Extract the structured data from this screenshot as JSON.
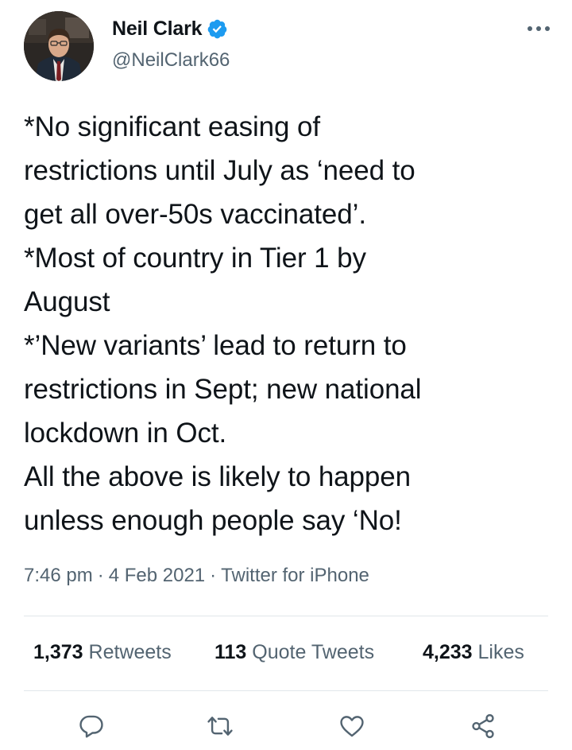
{
  "user": {
    "display_name": "Neil Clark",
    "handle": "@NeilClark66",
    "verified": true,
    "verified_color": "#1d9bf0"
  },
  "tweet": {
    "lines": [
      "*No significant easing of",
      "restrictions until July as ‘need to",
      "get all over-50s vaccinated’.",
      "*Most of country in Tier 1 by",
      "August",
      "*’New variants’ lead to return to",
      "restrictions in Sept; new national",
      "lockdown in Oct.",
      "All the above is likely to happen",
      "unless enough people say ‘No!"
    ]
  },
  "meta": {
    "time": "7:46 pm",
    "separator": "·",
    "date": "4 Feb 2021",
    "source": "Twitter for iPhone"
  },
  "stats": {
    "retweets": {
      "count": "1,373",
      "label": "Retweets"
    },
    "quote_tweets": {
      "count": "113",
      "label": "Quote Tweets"
    },
    "likes": {
      "count": "4,233",
      "label": "Likes"
    }
  },
  "icons": {
    "more": "more-dots-icon",
    "reply": "reply-icon",
    "retweet": "retweet-icon",
    "like": "heart-icon",
    "share": "share-icon"
  },
  "colors": {
    "text": "#0f1419",
    "secondary": "#536471",
    "divider": "#e1e6ea",
    "icon": "#536471"
  }
}
